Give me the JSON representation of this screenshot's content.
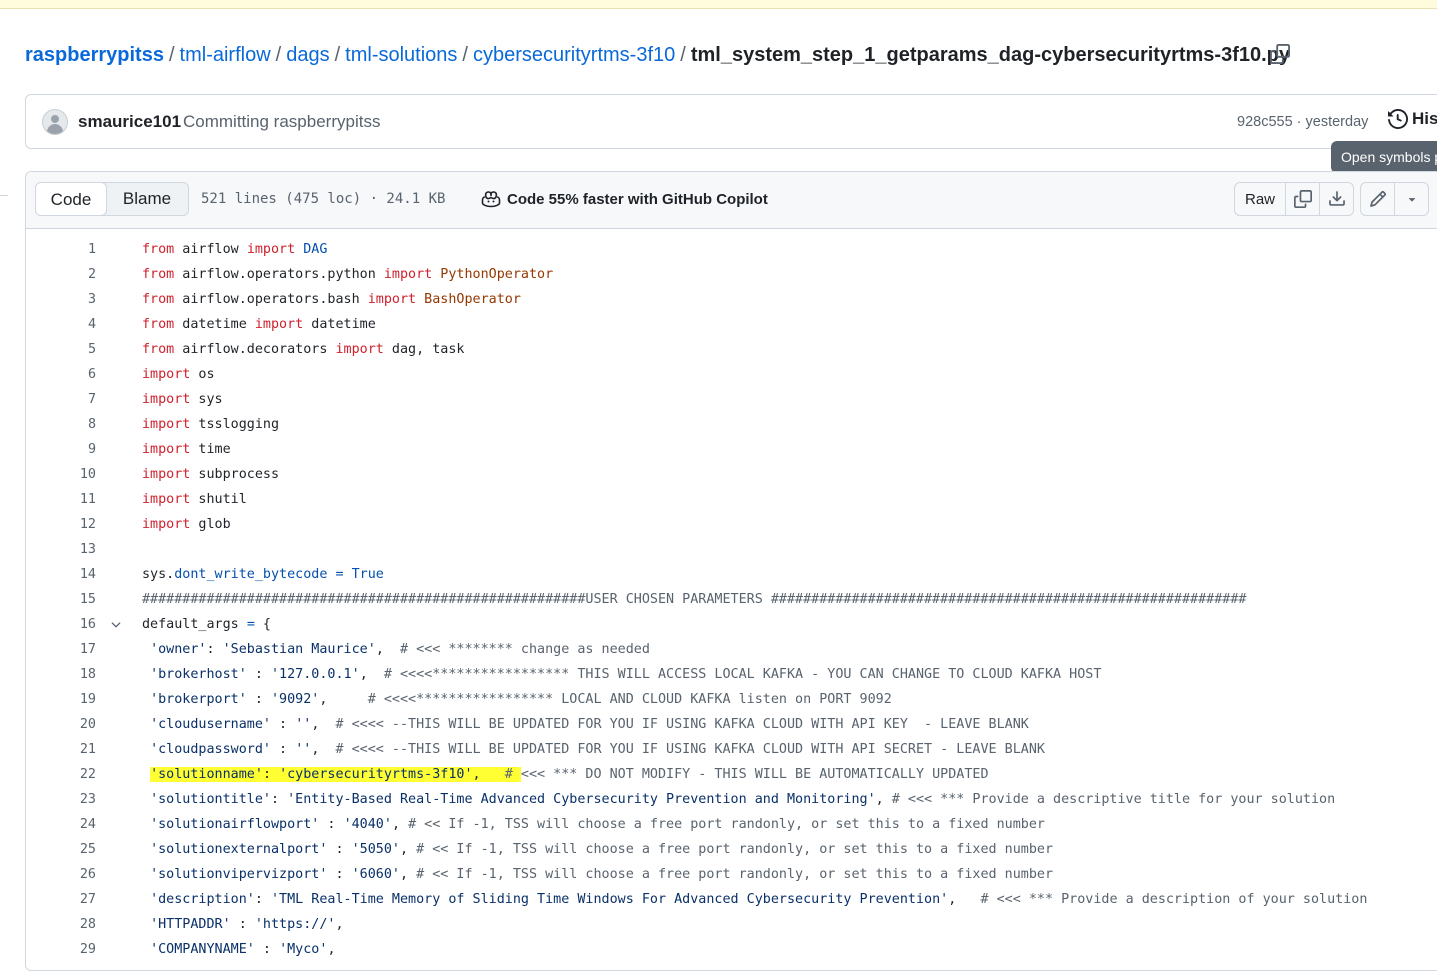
{
  "breadcrumb": {
    "repo": "raspberrypitss",
    "path": [
      "tml-airflow",
      "dags",
      "tml-solutions",
      "cybersecurityrtms-3f10"
    ],
    "separator": "/",
    "filename": "tml_system_step_1_getparams_dag-cybersecurityrtms-3f10.py"
  },
  "commit": {
    "author": "smaurice101",
    "message": "Committing raspberrypitss",
    "meta": "928c555 · yesterday",
    "history_label": "Hist"
  },
  "tooltip": {
    "text": "Open symbols p"
  },
  "file_header": {
    "tabs": [
      "Code",
      "Blame"
    ],
    "size": "521 lines (475 loc) · 24.1 KB",
    "copilot": "Code 55% faster with GitHub Copilot",
    "raw_label": "Raw"
  },
  "colors": {
    "link": "#0969da",
    "keyword": "#cf222e",
    "class": "#953800",
    "attr": "#0550ae",
    "string": "#0a3069",
    "highlight": "#ffff33"
  },
  "code": {
    "lines": [
      {
        "n": "1",
        "tokens": [
          {
            "t": "from",
            "c": "kw"
          },
          {
            "t": " airflow "
          },
          {
            "t": "import",
            "c": "kw"
          },
          {
            "t": " "
          },
          {
            "t": "DAG",
            "c": "attr"
          }
        ]
      },
      {
        "n": "2",
        "tokens": [
          {
            "t": "from",
            "c": "kw"
          },
          {
            "t": " airflow.operators.python "
          },
          {
            "t": "import",
            "c": "kw"
          },
          {
            "t": " "
          },
          {
            "t": "PythonOperator",
            "c": "cls"
          }
        ]
      },
      {
        "n": "3",
        "tokens": [
          {
            "t": "from",
            "c": "kw"
          },
          {
            "t": " airflow.operators.bash "
          },
          {
            "t": "import",
            "c": "kw"
          },
          {
            "t": " "
          },
          {
            "t": "BashOperator",
            "c": "cls"
          }
        ]
      },
      {
        "n": "4",
        "tokens": [
          {
            "t": "from",
            "c": "kw"
          },
          {
            "t": " datetime "
          },
          {
            "t": "import",
            "c": "kw"
          },
          {
            "t": " datetime"
          }
        ]
      },
      {
        "n": "5",
        "tokens": [
          {
            "t": "from",
            "c": "kw"
          },
          {
            "t": " airflow.decorators "
          },
          {
            "t": "import",
            "c": "kw"
          },
          {
            "t": " dag, task"
          }
        ]
      },
      {
        "n": "6",
        "tokens": [
          {
            "t": "import",
            "c": "kw"
          },
          {
            "t": " os"
          }
        ]
      },
      {
        "n": "7",
        "tokens": [
          {
            "t": "import",
            "c": "kw"
          },
          {
            "t": " sys"
          }
        ]
      },
      {
        "n": "8",
        "tokens": [
          {
            "t": "import",
            "c": "kw"
          },
          {
            "t": " tsslogging"
          }
        ]
      },
      {
        "n": "9",
        "tokens": [
          {
            "t": "import",
            "c": "kw"
          },
          {
            "t": " time"
          }
        ]
      },
      {
        "n": "10",
        "tokens": [
          {
            "t": "import",
            "c": "kw"
          },
          {
            "t": " subprocess"
          }
        ]
      },
      {
        "n": "11",
        "tokens": [
          {
            "t": "import",
            "c": "kw"
          },
          {
            "t": " shutil"
          }
        ]
      },
      {
        "n": "12",
        "tokens": [
          {
            "t": "import",
            "c": "kw"
          },
          {
            "t": " glob"
          }
        ]
      },
      {
        "n": "13",
        "tokens": []
      },
      {
        "n": "14",
        "tokens": [
          {
            "t": "sys."
          },
          {
            "t": "dont_write_bytecode",
            "c": "attr"
          },
          {
            "t": " "
          },
          {
            "t": "=",
            "c": "attr"
          },
          {
            "t": " "
          },
          {
            "t": "True",
            "c": "attr"
          }
        ]
      },
      {
        "n": "15",
        "tokens": [
          {
            "t": "#######################################################USER CHOSEN PARAMETERS ###########################################################",
            "c": "cmt"
          }
        ]
      },
      {
        "n": "16",
        "fold": true,
        "tokens": [
          {
            "t": "default_args "
          },
          {
            "t": "=",
            "c": "attr"
          },
          {
            "t": " {"
          }
        ]
      },
      {
        "n": "17",
        "tokens": [
          {
            "t": " "
          },
          {
            "t": "'owner'",
            "c": "str"
          },
          {
            "t": ": "
          },
          {
            "t": "'Sebastian Maurice'",
            "c": "str"
          },
          {
            "t": ",  "
          },
          {
            "t": "# <<< ******** change as needed",
            "c": "cmt"
          }
        ]
      },
      {
        "n": "18",
        "tokens": [
          {
            "t": " "
          },
          {
            "t": "'brokerhost'",
            "c": "str"
          },
          {
            "t": " : "
          },
          {
            "t": "'127.0.0.1'",
            "c": "str"
          },
          {
            "t": ",  "
          },
          {
            "t": "# <<<<***************** THIS WILL ACCESS LOCAL KAFKA - YOU CAN CHANGE TO CLOUD KAFKA HOST",
            "c": "cmt"
          }
        ]
      },
      {
        "n": "19",
        "tokens": [
          {
            "t": " "
          },
          {
            "t": "'brokerport'",
            "c": "str"
          },
          {
            "t": " : "
          },
          {
            "t": "'9092'",
            "c": "str"
          },
          {
            "t": ",     "
          },
          {
            "t": "# <<<<***************** LOCAL AND CLOUD KAFKA listen on PORT 9092",
            "c": "cmt"
          }
        ]
      },
      {
        "n": "20",
        "tokens": [
          {
            "t": " "
          },
          {
            "t": "'cloudusername'",
            "c": "str"
          },
          {
            "t": " : "
          },
          {
            "t": "''",
            "c": "str"
          },
          {
            "t": ",  "
          },
          {
            "t": "# <<<< --THIS WILL BE UPDATED FOR YOU IF USING KAFKA CLOUD WITH API KEY  - LEAVE BLANK",
            "c": "cmt"
          }
        ]
      },
      {
        "n": "21",
        "tokens": [
          {
            "t": " "
          },
          {
            "t": "'cloudpassword'",
            "c": "str"
          },
          {
            "t": " : "
          },
          {
            "t": "''",
            "c": "str"
          },
          {
            "t": ",  "
          },
          {
            "t": "# <<<< --THIS WILL BE UPDATED FOR YOU IF USING KAFKA CLOUD WITH API SECRET - LEAVE BLANK",
            "c": "cmt"
          }
        ]
      },
      {
        "n": "22",
        "tokens": [
          {
            "t": " "
          },
          {
            "t": "'solutionname'",
            "c": "str",
            "h": true
          },
          {
            "t": ": ",
            "h": true
          },
          {
            "t": "'cybersecurityrtms-3f10'",
            "c": "str",
            "h": true
          },
          {
            "t": ",   ",
            "h": true
          },
          {
            "t": "# ",
            "c": "cmt",
            "h": true
          },
          {
            "t": "<<< *** DO NOT MODIFY - THIS WILL BE AUTOMATICALLY UPDATED",
            "c": "cmt"
          }
        ]
      },
      {
        "n": "23",
        "tokens": [
          {
            "t": " "
          },
          {
            "t": "'solutiontitle'",
            "c": "str"
          },
          {
            "t": ": "
          },
          {
            "t": "'Entity-Based Real-Time Advanced Cybersecurity Prevention and Monitoring'",
            "c": "str"
          },
          {
            "t": ", "
          },
          {
            "t": "# <<< *** Provide a descriptive title for your solution",
            "c": "cmt"
          }
        ]
      },
      {
        "n": "24",
        "tokens": [
          {
            "t": " "
          },
          {
            "t": "'solutionairflowport'",
            "c": "str"
          },
          {
            "t": " : "
          },
          {
            "t": "'4040'",
            "c": "str"
          },
          {
            "t": ", "
          },
          {
            "t": "# << If -1, TSS will choose a free port randonly, or set this to a fixed number",
            "c": "cmt"
          }
        ]
      },
      {
        "n": "25",
        "tokens": [
          {
            "t": " "
          },
          {
            "t": "'solutionexternalport'",
            "c": "str"
          },
          {
            "t": " : "
          },
          {
            "t": "'5050'",
            "c": "str"
          },
          {
            "t": ", "
          },
          {
            "t": "# << If -1, TSS will choose a free port randonly, or set this to a fixed number",
            "c": "cmt"
          }
        ]
      },
      {
        "n": "26",
        "tokens": [
          {
            "t": " "
          },
          {
            "t": "'solutionvipervizport'",
            "c": "str"
          },
          {
            "t": " : "
          },
          {
            "t": "'6060'",
            "c": "str"
          },
          {
            "t": ", "
          },
          {
            "t": "# << If -1, TSS will choose a free port randonly, or set this to a fixed number",
            "c": "cmt"
          }
        ]
      },
      {
        "n": "27",
        "tokens": [
          {
            "t": " "
          },
          {
            "t": "'description'",
            "c": "str"
          },
          {
            "t": ": "
          },
          {
            "t": "'TML Real-Time Memory of Sliding Time Windows For Advanced Cybersecurity Prevention'",
            "c": "str"
          },
          {
            "t": ",   "
          },
          {
            "t": "# <<< *** Provide a description of your solution",
            "c": "cmt"
          }
        ]
      },
      {
        "n": "28",
        "tokens": [
          {
            "t": " "
          },
          {
            "t": "'HTTPADDR'",
            "c": "str"
          },
          {
            "t": " : "
          },
          {
            "t": "'https://'",
            "c": "str"
          },
          {
            "t": ","
          }
        ]
      },
      {
        "n": "29",
        "tokens": [
          {
            "t": " "
          },
          {
            "t": "'COMPANYNAME'",
            "c": "str"
          },
          {
            "t": " : "
          },
          {
            "t": "'Myco'",
            "c": "str"
          },
          {
            "t": ","
          }
        ]
      }
    ]
  }
}
